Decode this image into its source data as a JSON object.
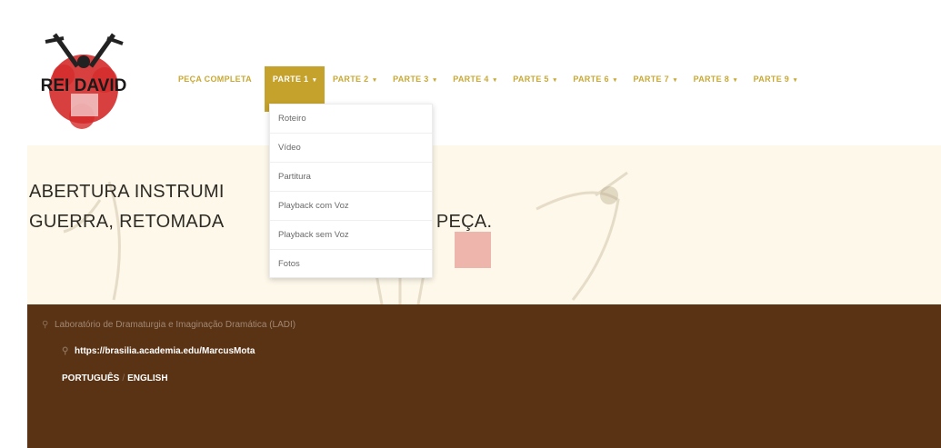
{
  "nav": {
    "items": [
      {
        "label": "PEÇA COMPLETA",
        "caret": ""
      },
      {
        "label": "PARTE 1",
        "caret": "▾"
      },
      {
        "label": "PARTE 2",
        "caret": "▾"
      },
      {
        "label": "PARTE 3",
        "caret": "▾"
      },
      {
        "label": "PARTE 4",
        "caret": "▾"
      },
      {
        "label": "PARTE 5",
        "caret": "▾"
      },
      {
        "label": "PARTE 6",
        "caret": "▾"
      },
      {
        "label": "PARTE 7",
        "caret": "▾"
      },
      {
        "label": "PARTE 8",
        "caret": "▾"
      },
      {
        "label": "PARTE 9",
        "caret": "▾"
      }
    ],
    "active_index": 1
  },
  "logo": {
    "text": "REI DAVID",
    "icon": "throne-logo-icon"
  },
  "dropdown": {
    "items": [
      "Roteiro",
      "Vídeo",
      "Partitura",
      "Playback com Voz",
      "Playback sem Voz",
      "Fotos"
    ]
  },
  "hero": {
    "line1": "ABERTURA INSTRUMI",
    "line2": "GUERRA, RETOMADA",
    "line2_tail": "A PEÇA."
  },
  "footer": {
    "lab_text": "Laboratório de Dramaturgia e Imaginação Dramática (LADI)",
    "url": "https://brasilia.academia.edu/MarcusMota",
    "lang_pt": "PORTUGUÊS",
    "lang_sep": "/",
    "lang_en": "ENGLISH",
    "pin_icon": "map-marker-icon"
  },
  "colors": {
    "accent": "#c4a22c",
    "footer_bg": "#5a3214",
    "logo_red": "#d42a2a"
  }
}
